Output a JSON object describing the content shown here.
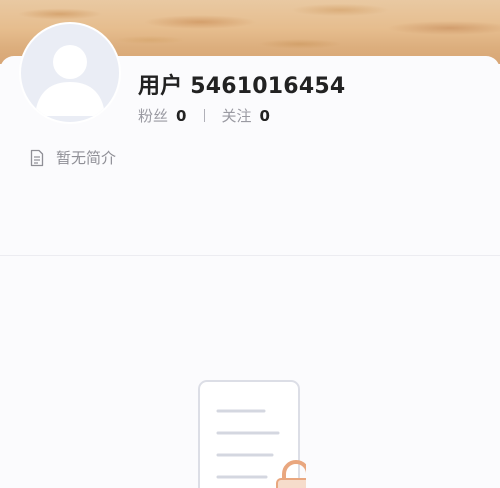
{
  "profile": {
    "username": "用户 5461016454",
    "fans_label": "粉丝",
    "fans_count": "0",
    "following_label": "关注",
    "following_count": "0",
    "bio": "暂无简介"
  },
  "icons": {
    "avatar": "default-avatar-silhouette",
    "bio": "document-icon",
    "empty": "locked-document-illustration"
  },
  "colors": {
    "lock_accent": "#e9a77f",
    "text_primary": "#222222",
    "text_secondary": "#9a9aa2"
  }
}
